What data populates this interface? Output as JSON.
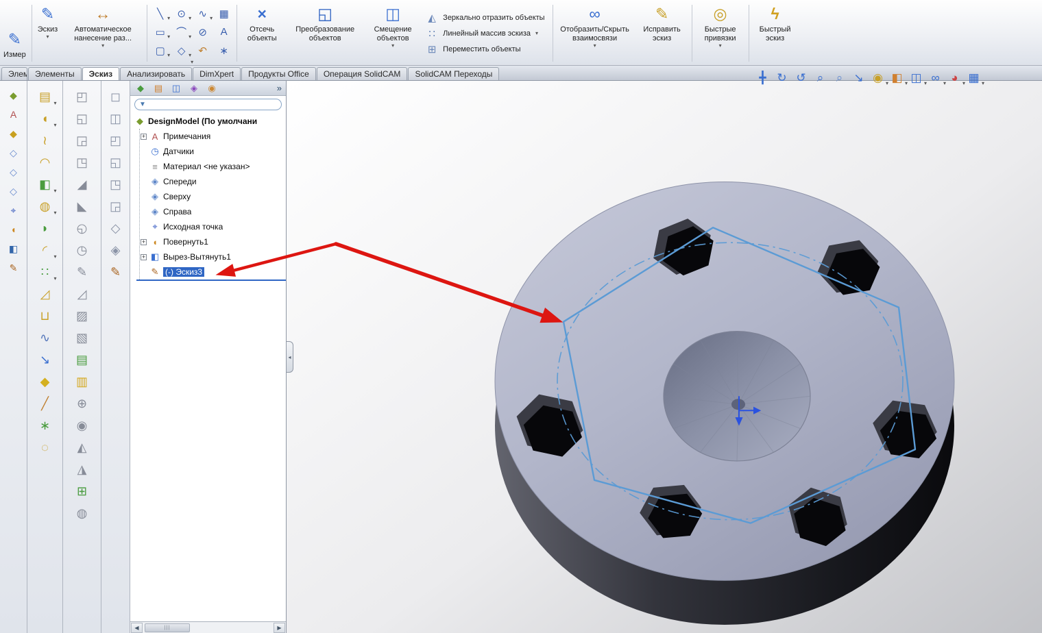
{
  "ui": {
    "caret": "▾",
    "chevron": "»",
    "scroll_left": "◀",
    "scroll_right": "▶",
    "scroll_grip": "|||",
    "expander": "+",
    "funnel_icon": "▼",
    "splitter_grip": "◂"
  },
  "colors": {
    "selection_blue": "#2f66c4",
    "sketch_blue": "#5b9bd5",
    "arrow_red": "#dd1611",
    "origin_blue": "#2a52e0"
  },
  "ribbon": {
    "measure": {
      "label": "Измер",
      "icon": "✎"
    },
    "sketch": {
      "label": "Эскиз",
      "icon": "✎"
    },
    "autodim": {
      "label": "Автоматическое нанесение раз...",
      "icon": "↔"
    },
    "trim": {
      "label": "Отсечь объекты",
      "icon": "×"
    },
    "convert": {
      "label": "Преобразование объектов",
      "icon": "◱"
    },
    "offset": {
      "label": "Смещение объектов",
      "icon": "◫"
    },
    "mirror": {
      "label": "Зеркально отразить объекты",
      "icon": "◭"
    },
    "linear_pattern": {
      "label": "Линейный массив эскиза",
      "icon": "∷"
    },
    "move": {
      "label": "Переместить объекты",
      "icon": "⊞"
    },
    "relations": {
      "label": "Отобразить/Скрыть взаимосвязи",
      "icon": "∞"
    },
    "repair": {
      "label": "Исправить эскиз",
      "icon": "✎"
    },
    "snaps": {
      "label": "Быстрые привязки",
      "icon": "◎"
    },
    "rapid": {
      "label": "Быстрый эскиз",
      "icon": "ϟ"
    }
  },
  "sketch_grid": [
    {
      "n": "line-tool-icon",
      "g": "╲",
      "c": "#3a5fae",
      "caret": true
    },
    {
      "n": "circle-tool-icon",
      "g": "⊙",
      "c": "#3a5fae",
      "caret": true
    },
    {
      "n": "spline-tool-icon",
      "g": "∿",
      "c": "#3a5fae",
      "caret": true
    },
    {
      "n": "sketch-pattern-tool-icon",
      "g": "▦",
      "c": "#3a5fae"
    },
    {
      "n": "rectangle-tool-icon",
      "g": "▭",
      "c": "#3a5fae",
      "caret": true
    },
    {
      "n": "arc-tool-icon",
      "g": "⌒",
      "c": "#3a5fae",
      "caret": true
    },
    {
      "n": "ellipse-tool-icon",
      "g": "⊘",
      "c": "#3a5fae"
    },
    {
      "n": "text-tool-icon",
      "g": "A",
      "c": "#3a5fae"
    },
    {
      "n": "slot-tool-icon",
      "g": "▢",
      "c": "#3a5fae",
      "caret": true
    },
    {
      "n": "polygon-tool-icon",
      "g": "◇",
      "c": "#3a5fae",
      "caret": true
    },
    {
      "n": "three-point-arc-tool-icon",
      "g": "↶",
      "c": "#c08030"
    },
    {
      "n": "point-tool-icon",
      "g": "∗",
      "c": "#3a5fae"
    }
  ],
  "tabs": [
    {
      "label": "Элем",
      "cut": true
    },
    {
      "label": "Элементы"
    },
    {
      "label": "Эскиз",
      "active": true
    },
    {
      "label": "Анализировать"
    },
    {
      "label": "DimXpert"
    },
    {
      "label": "Продукты Office"
    },
    {
      "label": "Операция  SolidCAM"
    },
    {
      "label": "SolidCAM Переходы"
    }
  ],
  "view_toolbar": [
    {
      "n": "pan-icon",
      "g": "╋",
      "c": "#3a6fd0"
    },
    {
      "n": "rotate-view-icon",
      "g": "↻",
      "c": "#3a6fd0"
    },
    {
      "n": "roll-view-icon",
      "g": "↺",
      "c": "#3a6fd0"
    },
    {
      "n": "zoom-fit-icon",
      "g": "⌕",
      "c": "#3a6fd0"
    },
    {
      "n": "zoom-area-icon",
      "g": "⌕",
      "c": "#6a8fd0"
    },
    {
      "n": "selection-filter-icon",
      "g": "↘",
      "c": "#3a6fd0"
    },
    {
      "n": "shaded-with-edges-icon",
      "g": "◉",
      "c": "#c8a028",
      "caret": true
    },
    {
      "n": "section-view-icon",
      "g": "◧",
      "c": "#d08030",
      "caret": true
    },
    {
      "n": "view-orientation-icon",
      "g": "◫",
      "c": "#3a6fd0",
      "caret": true
    },
    {
      "n": "hide-show-items-icon",
      "g": "∞",
      "c": "#3a6fd0",
      "caret": true
    },
    {
      "n": "appearance-icon",
      "g": "◕",
      "c": "#cc4444",
      "caret": true
    },
    {
      "n": "scene-settings-icon",
      "g": "▦",
      "c": "#3a6fd0",
      "caret": true
    }
  ],
  "panel_tabs": [
    {
      "n": "featuremanager-tab-icon",
      "g": "◆",
      "c": "#4a9c3f"
    },
    {
      "n": "propertymanager-tab-icon",
      "g": "▤",
      "c": "#d08030"
    },
    {
      "n": "configurationmanager-tab-icon",
      "g": "◫",
      "c": "#3a6fd0"
    },
    {
      "n": "dimxpertmanager-tab-icon",
      "g": "◈",
      "c": "#8844bb"
    },
    {
      "n": "displaymanager-tab-icon",
      "g": "◉",
      "c": "#cc8833"
    }
  ],
  "left_strip": [
    {
      "n": "part-tree-icon",
      "g": "◆",
      "c": "#7a9c2f"
    },
    {
      "n": "annotations-icon",
      "g": "A",
      "c": "#b05050"
    },
    {
      "n": "solid-body-icon",
      "g": "◆",
      "c": "#c8a020"
    },
    {
      "n": "front-plane-icon",
      "g": "◇",
      "c": "#6688cc"
    },
    {
      "n": "top-plane-icon",
      "g": "◇",
      "c": "#6688cc"
    },
    {
      "n": "right-plane-icon",
      "g": "◇",
      "c": "#6688cc"
    },
    {
      "n": "origin-icon",
      "g": "⌖",
      "c": "#3355bb"
    },
    {
      "n": "revolve-feature-icon",
      "g": "◖",
      "c": "#cc8822"
    },
    {
      "n": "cut-extrude-feature-icon",
      "g": "◧",
      "c": "#3366aa"
    },
    {
      "n": "sketch-feature-icon",
      "g": "✎",
      "c": "#aa6622"
    }
  ],
  "features_column": [
    {
      "n": "extruded-boss-icon",
      "g": "▤",
      "c": "#c8a028",
      "caret": true
    },
    {
      "n": "revolved-boss-icon",
      "g": "◖",
      "c": "#c8a028",
      "caret": true
    },
    {
      "n": "swept-boss-icon",
      "g": "≀",
      "c": "#c8a028"
    },
    {
      "n": "lofted-boss-icon",
      "g": "◠",
      "c": "#c8a028"
    },
    {
      "n": "extruded-cut-icon",
      "g": "◧",
      "c": "#4a9c3f",
      "caret": true
    },
    {
      "n": "hole-wizard-icon",
      "g": "◍",
      "c": "#c8a028",
      "caret": true
    },
    {
      "n": "revolved-cut-icon",
      "g": "◗",
      "c": "#4a9c3f"
    },
    {
      "n": "fillet-icon",
      "g": "◜",
      "c": "#c8a028",
      "caret": true
    },
    {
      "n": "linear-pattern-icon",
      "g": "∷",
      "c": "#4a9c3f",
      "caret": true
    },
    {
      "n": "draft-icon",
      "g": "◿",
      "c": "#c8a028"
    },
    {
      "n": "shell-icon",
      "g": "⊔",
      "c": "#c8a028"
    },
    {
      "n": "wrap-icon",
      "g": "∿",
      "c": "#5577bb"
    },
    {
      "n": "instant3d-icon",
      "g": "↘",
      "c": "#3a6fd0"
    },
    {
      "n": "smart-dimension-icon",
      "g": "◆",
      "c": "#d4b020"
    },
    {
      "n": "centerline-icon",
      "g": "╱",
      "c": "#c08030"
    },
    {
      "n": "reference-point-icon",
      "g": "∗",
      "c": "#4a9c3f"
    },
    {
      "n": "attachment-icon",
      "g": "◌",
      "c": "#c8a028"
    }
  ],
  "surfaces_column": [
    {
      "n": "extruded-surface-icon",
      "g": "◰",
      "c": "#878c98"
    },
    {
      "n": "revolved-surface-icon",
      "g": "◱",
      "c": "#878c98"
    },
    {
      "n": "swept-surface-icon",
      "g": "◲",
      "c": "#878c98"
    },
    {
      "n": "lofted-surface-icon",
      "g": "◳",
      "c": "#878c98"
    },
    {
      "n": "boundary-surface-icon",
      "g": "◢",
      "c": "#878c98"
    },
    {
      "n": "filled-surface-icon",
      "g": "◣",
      "c": "#878c98"
    },
    {
      "n": "planar-surface-icon",
      "g": "◵",
      "c": "#878c98"
    },
    {
      "n": "offset-surface-icon",
      "g": "◷",
      "c": "#878c98"
    },
    {
      "n": "ruled-surface-icon",
      "g": "✎",
      "c": "#878c98"
    },
    {
      "n": "delete-face-icon",
      "g": "◿",
      "c": "#878c98"
    },
    {
      "n": "replace-face-icon",
      "g": "▨",
      "c": "#878c98"
    },
    {
      "n": "extend-surface-icon",
      "g": "▧",
      "c": "#878c98"
    },
    {
      "n": "trim-surface-icon",
      "g": "▤",
      "c": "#4a9c3f"
    },
    {
      "n": "untrim-surface-icon",
      "g": "▥",
      "c": "#d4a820"
    },
    {
      "n": "knit-surface-icon",
      "g": "⊕",
      "c": "#878c98"
    },
    {
      "n": "thicken-icon",
      "g": "◉",
      "c": "#878c98"
    },
    {
      "n": "cut-with-surface-icon",
      "g": "◭",
      "c": "#878c98"
    },
    {
      "n": "mold-tool-icon",
      "g": "◮",
      "c": "#878c98"
    },
    {
      "n": "parting-line-icon",
      "g": "⊞",
      "c": "#4a9c3f"
    },
    {
      "n": "draft-analysis-icon",
      "g": "◍",
      "c": "#878c98"
    }
  ],
  "views_column": [
    {
      "n": "front-view-icon",
      "g": "◻",
      "c": "#8a93a6"
    },
    {
      "n": "back-view-icon",
      "g": "◫",
      "c": "#8a93a6"
    },
    {
      "n": "left-view-icon",
      "g": "◰",
      "c": "#8a93a6"
    },
    {
      "n": "right-view-icon",
      "g": "◱",
      "c": "#8a93a6"
    },
    {
      "n": "top-view-icon",
      "g": "◳",
      "c": "#8a93a6"
    },
    {
      "n": "bottom-view-icon",
      "g": "◲",
      "c": "#8a93a6"
    },
    {
      "n": "isometric-view-icon",
      "g": "◇",
      "c": "#8a93a6"
    },
    {
      "n": "normal-to-view-icon",
      "g": "◈",
      "c": "#8a93a6"
    },
    {
      "n": "edit-sketch-icon",
      "g": "✎",
      "c": "#aa6622"
    }
  ],
  "tree": {
    "root": {
      "label": "DesignModel  (По умолчани",
      "icon": "part-icon",
      "g": "◆",
      "c": "#7a9c2f"
    },
    "items": [
      {
        "label": "Примечания",
        "icon": "annotations-folder-icon",
        "g": "A",
        "c": "#b05050",
        "exp": true
      },
      {
        "label": "Датчики",
        "icon": "sensors-icon",
        "g": "◷",
        "c": "#3a6fd0"
      },
      {
        "label": "Материал <не указан>",
        "icon": "material-icon",
        "g": "≡",
        "c": "#888888"
      },
      {
        "label": "Спереди",
        "icon": "front-plane-icon",
        "g": "◈",
        "c": "#5c85c8"
      },
      {
        "label": "Сверху",
        "icon": "top-plane-icon",
        "g": "◈",
        "c": "#5c85c8"
      },
      {
        "label": "Справа",
        "icon": "right-plane-icon",
        "g": "◈",
        "c": "#5c85c8"
      },
      {
        "label": "Исходная точка",
        "icon": "origin-icon",
        "g": "⌖",
        "c": "#2f55c0"
      },
      {
        "label": "Повернуть1",
        "icon": "revolve-feature-icon",
        "g": "◖",
        "c": "#cc8822",
        "exp": true
      },
      {
        "label": "Вырез-Вытянуть1",
        "icon": "cut-extrude-feature-icon",
        "g": "◧",
        "c": "#3a6fd0",
        "exp": true
      },
      {
        "label": "(-) Эскиз3",
        "icon": "sketch-feature-icon",
        "g": "✎",
        "c": "#aa6622",
        "selected": true
      }
    ],
    "filter_value": ""
  },
  "viewport": {
    "background_top": "#ffffff",
    "background_bottom": "#c2c3c7",
    "part_top_color": "#b4b8cb",
    "part_side_color": "#26272e",
    "sketch_color": "#5b9bd5",
    "arrow_color": "#dd1611",
    "origin_color": "#2a52e0"
  }
}
